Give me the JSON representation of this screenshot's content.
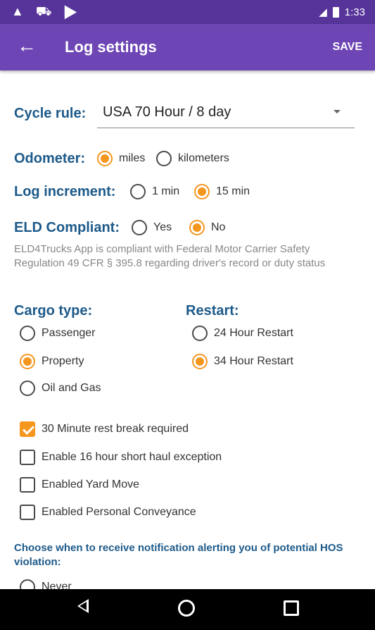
{
  "statusbar": {
    "left_icons": "▲ ⛟ ▶",
    "signal": "◢",
    "time": "1:33"
  },
  "appbar": {
    "back": "←",
    "title": "Log settings",
    "save": "SAVE"
  },
  "cycle_rule": {
    "label": "Cycle rule:",
    "value": "USA 70 Hour / 8 day"
  },
  "odometer": {
    "label": "Odometer:",
    "options": [
      "miles",
      "kilometers"
    ],
    "selected": "miles"
  },
  "log_increment": {
    "label": "Log increment:",
    "options": [
      "1 min",
      "15 min"
    ],
    "selected": "15 min"
  },
  "eld": {
    "label": "ELD Compliant:",
    "options": [
      "Yes",
      "No"
    ],
    "selected": "No",
    "note": "ELD4Trucks App is compliant with Federal Motor Carrier Safety Regulation 49 CFR § 395.8 regarding driver's record or duty status"
  },
  "cargo": {
    "label": "Cargo type:",
    "options": [
      "Passenger",
      "Property",
      "Oil and Gas"
    ],
    "selected": "Property"
  },
  "restart": {
    "label": "Restart:",
    "options": [
      "24 Hour Restart",
      "34 Hour Restart"
    ],
    "selected": "34 Hour Restart"
  },
  "checkboxes": [
    {
      "label": "30 Minute rest break required",
      "checked": true
    },
    {
      "label": "Enable 16 hour short haul exception",
      "checked": false
    },
    {
      "label": "Enabled Yard Move",
      "checked": false
    },
    {
      "label": "Enabled Personal Conveyance",
      "checked": false
    }
  ],
  "notification": {
    "heading": "Choose when to receive notification alerting you of potential HOS violation:",
    "first_option": "Never"
  },
  "colors": {
    "status_bar": "#56349a",
    "app_bar": "#6d45b5",
    "accent": "#f5961f",
    "label": "#1d5a8a"
  },
  "icons": [
    "warning-icon",
    "car-icon",
    "play-icon",
    "signal-icon",
    "battery-icon",
    "back-arrow-icon",
    "dropdown-arrow-icon",
    "nav-back-icon",
    "nav-home-icon",
    "nav-recent-icon"
  ]
}
